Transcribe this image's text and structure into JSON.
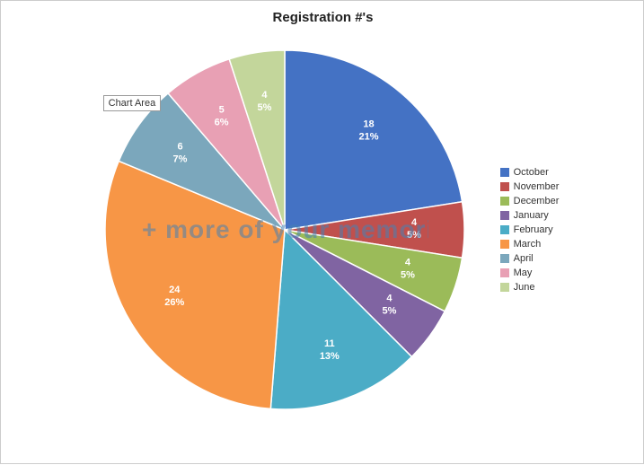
{
  "title": "Registration #'s",
  "chartAreaLabel": "Chart Area",
  "photobucketText": "+ more of your memori",
  "legend": {
    "items": [
      {
        "label": "October",
        "color": "#4472C4"
      },
      {
        "label": "November",
        "color": "#C0504D"
      },
      {
        "label": "December",
        "color": "#9BBB59"
      },
      {
        "label": "January",
        "color": "#8064A2"
      },
      {
        "label": "February",
        "color": "#4BACC6"
      },
      {
        "label": "March",
        "color": "#F79646"
      },
      {
        "label": "April",
        "color": "#7BA7BC"
      },
      {
        "label": "May",
        "color": "#E8A0B4"
      },
      {
        "label": "June",
        "color": "#C3D69B"
      }
    ]
  },
  "slices": [
    {
      "month": "October",
      "value": 18,
      "pct": 21,
      "color": "#4472C4"
    },
    {
      "month": "November",
      "value": 4,
      "pct": 5,
      "color": "#C0504D"
    },
    {
      "month": "December",
      "value": 4,
      "pct": 5,
      "color": "#9BBB59"
    },
    {
      "month": "January",
      "value": 4,
      "pct": 5,
      "color": "#8064A2"
    },
    {
      "month": "February",
      "value": 11,
      "pct": 13,
      "color": "#4BACC6"
    },
    {
      "month": "March",
      "value": 24,
      "pct": 26,
      "color": "#F79646"
    },
    {
      "month": "April",
      "value": 6,
      "pct": 7,
      "color": "#7BA7BC"
    },
    {
      "month": "May",
      "value": 5,
      "pct": 6,
      "color": "#E8A0B4"
    },
    {
      "month": "June",
      "value": 4,
      "pct": 5,
      "color": "#C3D69B"
    }
  ]
}
